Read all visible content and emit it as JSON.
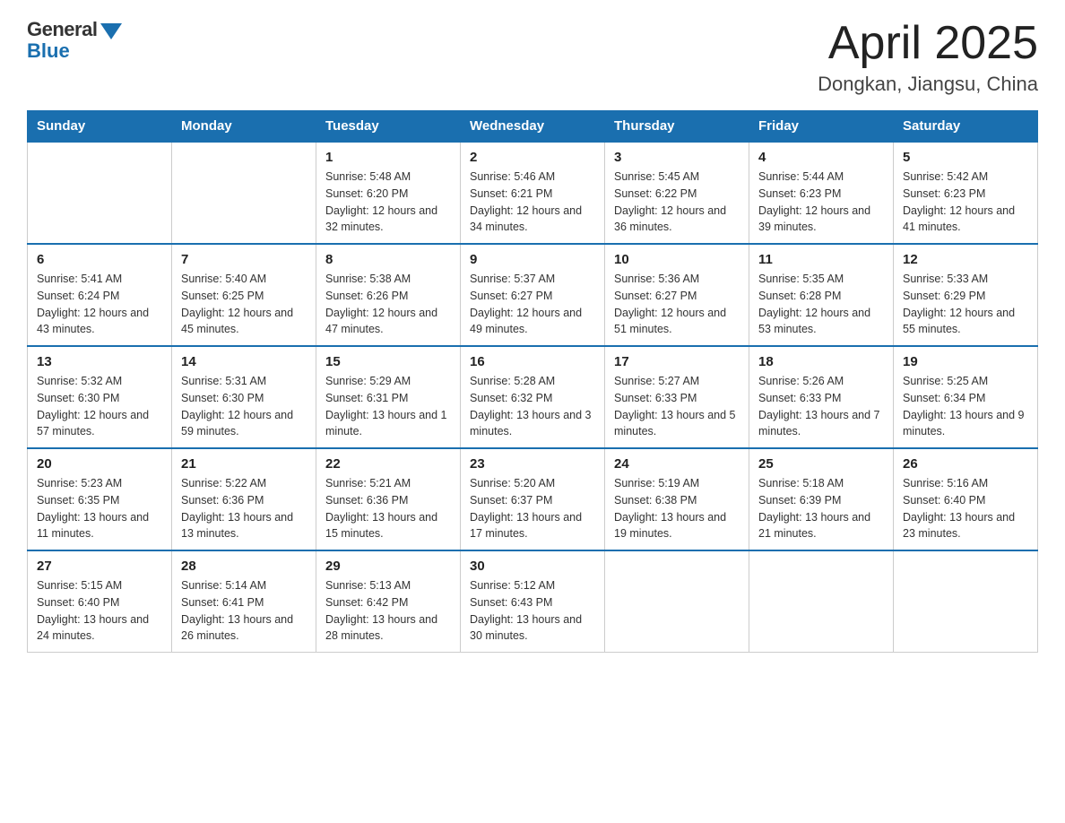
{
  "header": {
    "logo_general": "General",
    "logo_blue": "Blue",
    "title": "April 2025",
    "subtitle": "Dongkan, Jiangsu, China"
  },
  "days_of_week": [
    "Sunday",
    "Monday",
    "Tuesday",
    "Wednesday",
    "Thursday",
    "Friday",
    "Saturday"
  ],
  "weeks": [
    [
      null,
      null,
      {
        "day": "1",
        "sunrise": "Sunrise: 5:48 AM",
        "sunset": "Sunset: 6:20 PM",
        "daylight": "Daylight: 12 hours and 32 minutes."
      },
      {
        "day": "2",
        "sunrise": "Sunrise: 5:46 AM",
        "sunset": "Sunset: 6:21 PM",
        "daylight": "Daylight: 12 hours and 34 minutes."
      },
      {
        "day": "3",
        "sunrise": "Sunrise: 5:45 AM",
        "sunset": "Sunset: 6:22 PM",
        "daylight": "Daylight: 12 hours and 36 minutes."
      },
      {
        "day": "4",
        "sunrise": "Sunrise: 5:44 AM",
        "sunset": "Sunset: 6:23 PM",
        "daylight": "Daylight: 12 hours and 39 minutes."
      },
      {
        "day": "5",
        "sunrise": "Sunrise: 5:42 AM",
        "sunset": "Sunset: 6:23 PM",
        "daylight": "Daylight: 12 hours and 41 minutes."
      }
    ],
    [
      {
        "day": "6",
        "sunrise": "Sunrise: 5:41 AM",
        "sunset": "Sunset: 6:24 PM",
        "daylight": "Daylight: 12 hours and 43 minutes."
      },
      {
        "day": "7",
        "sunrise": "Sunrise: 5:40 AM",
        "sunset": "Sunset: 6:25 PM",
        "daylight": "Daylight: 12 hours and 45 minutes."
      },
      {
        "day": "8",
        "sunrise": "Sunrise: 5:38 AM",
        "sunset": "Sunset: 6:26 PM",
        "daylight": "Daylight: 12 hours and 47 minutes."
      },
      {
        "day": "9",
        "sunrise": "Sunrise: 5:37 AM",
        "sunset": "Sunset: 6:27 PM",
        "daylight": "Daylight: 12 hours and 49 minutes."
      },
      {
        "day": "10",
        "sunrise": "Sunrise: 5:36 AM",
        "sunset": "Sunset: 6:27 PM",
        "daylight": "Daylight: 12 hours and 51 minutes."
      },
      {
        "day": "11",
        "sunrise": "Sunrise: 5:35 AM",
        "sunset": "Sunset: 6:28 PM",
        "daylight": "Daylight: 12 hours and 53 minutes."
      },
      {
        "day": "12",
        "sunrise": "Sunrise: 5:33 AM",
        "sunset": "Sunset: 6:29 PM",
        "daylight": "Daylight: 12 hours and 55 minutes."
      }
    ],
    [
      {
        "day": "13",
        "sunrise": "Sunrise: 5:32 AM",
        "sunset": "Sunset: 6:30 PM",
        "daylight": "Daylight: 12 hours and 57 minutes."
      },
      {
        "day": "14",
        "sunrise": "Sunrise: 5:31 AM",
        "sunset": "Sunset: 6:30 PM",
        "daylight": "Daylight: 12 hours and 59 minutes."
      },
      {
        "day": "15",
        "sunrise": "Sunrise: 5:29 AM",
        "sunset": "Sunset: 6:31 PM",
        "daylight": "Daylight: 13 hours and 1 minute."
      },
      {
        "day": "16",
        "sunrise": "Sunrise: 5:28 AM",
        "sunset": "Sunset: 6:32 PM",
        "daylight": "Daylight: 13 hours and 3 minutes."
      },
      {
        "day": "17",
        "sunrise": "Sunrise: 5:27 AM",
        "sunset": "Sunset: 6:33 PM",
        "daylight": "Daylight: 13 hours and 5 minutes."
      },
      {
        "day": "18",
        "sunrise": "Sunrise: 5:26 AM",
        "sunset": "Sunset: 6:33 PM",
        "daylight": "Daylight: 13 hours and 7 minutes."
      },
      {
        "day": "19",
        "sunrise": "Sunrise: 5:25 AM",
        "sunset": "Sunset: 6:34 PM",
        "daylight": "Daylight: 13 hours and 9 minutes."
      }
    ],
    [
      {
        "day": "20",
        "sunrise": "Sunrise: 5:23 AM",
        "sunset": "Sunset: 6:35 PM",
        "daylight": "Daylight: 13 hours and 11 minutes."
      },
      {
        "day": "21",
        "sunrise": "Sunrise: 5:22 AM",
        "sunset": "Sunset: 6:36 PM",
        "daylight": "Daylight: 13 hours and 13 minutes."
      },
      {
        "day": "22",
        "sunrise": "Sunrise: 5:21 AM",
        "sunset": "Sunset: 6:36 PM",
        "daylight": "Daylight: 13 hours and 15 minutes."
      },
      {
        "day": "23",
        "sunrise": "Sunrise: 5:20 AM",
        "sunset": "Sunset: 6:37 PM",
        "daylight": "Daylight: 13 hours and 17 minutes."
      },
      {
        "day": "24",
        "sunrise": "Sunrise: 5:19 AM",
        "sunset": "Sunset: 6:38 PM",
        "daylight": "Daylight: 13 hours and 19 minutes."
      },
      {
        "day": "25",
        "sunrise": "Sunrise: 5:18 AM",
        "sunset": "Sunset: 6:39 PM",
        "daylight": "Daylight: 13 hours and 21 minutes."
      },
      {
        "day": "26",
        "sunrise": "Sunrise: 5:16 AM",
        "sunset": "Sunset: 6:40 PM",
        "daylight": "Daylight: 13 hours and 23 minutes."
      }
    ],
    [
      {
        "day": "27",
        "sunrise": "Sunrise: 5:15 AM",
        "sunset": "Sunset: 6:40 PM",
        "daylight": "Daylight: 13 hours and 24 minutes."
      },
      {
        "day": "28",
        "sunrise": "Sunrise: 5:14 AM",
        "sunset": "Sunset: 6:41 PM",
        "daylight": "Daylight: 13 hours and 26 minutes."
      },
      {
        "day": "29",
        "sunrise": "Sunrise: 5:13 AM",
        "sunset": "Sunset: 6:42 PM",
        "daylight": "Daylight: 13 hours and 28 minutes."
      },
      {
        "day": "30",
        "sunrise": "Sunrise: 5:12 AM",
        "sunset": "Sunset: 6:43 PM",
        "daylight": "Daylight: 13 hours and 30 minutes."
      },
      null,
      null,
      null
    ]
  ]
}
